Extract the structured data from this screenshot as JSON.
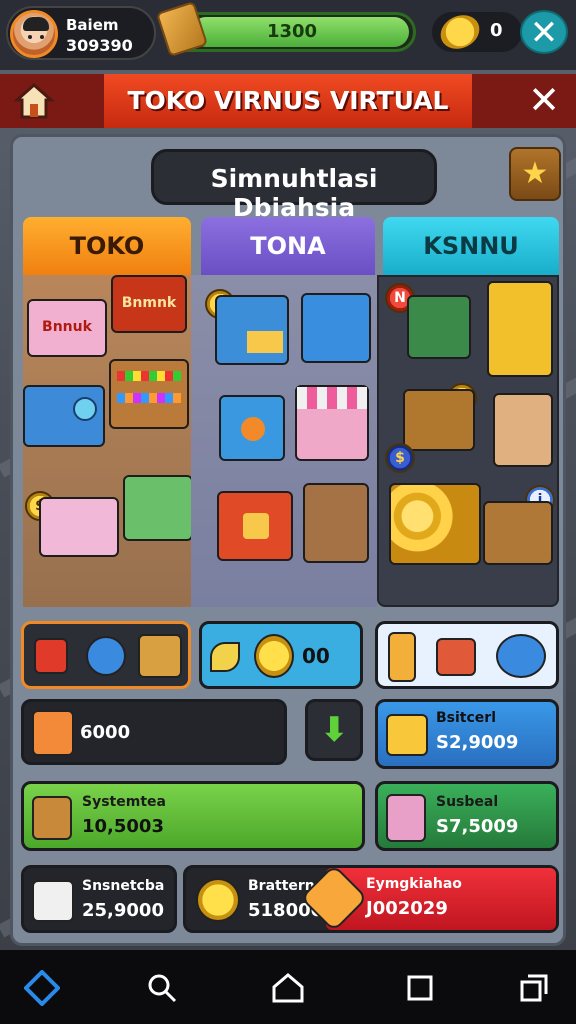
{
  "profile": {
    "name": "Baiem",
    "id": "309390"
  },
  "resource": {
    "value": "1300",
    "fill_fraction": 0.93
  },
  "coins": {
    "value": "0"
  },
  "header": {
    "title": "TOKO VIRNUS VIRTUAL"
  },
  "subtitle": "Simnuhtlasi Dbiahsia",
  "tabs": [
    {
      "label": "TOKO",
      "color": "#f08010"
    },
    {
      "label": "TONA",
      "color": "#6a4fc4"
    },
    {
      "label": "KSNNU",
      "color": "#18aecb"
    }
  ],
  "toko_items": {
    "sign1": "Bnnuk",
    "sign2": "Bnmnk"
  },
  "row1": {
    "middle_value": "00"
  },
  "row2": {
    "left_value": "6000",
    "right": {
      "label": "Bsitcerl",
      "value": "S2,9009"
    }
  },
  "row3": {
    "left": {
      "label": "Systemtea",
      "value": "10,5003"
    },
    "right": {
      "label": "Susbeal",
      "value": "S7,5009"
    }
  },
  "row4": {
    "a": {
      "label": "Snsnetcba",
      "value": "25,9000"
    },
    "b": {
      "label": "Brattern",
      "value": "5180001"
    },
    "c": {
      "label": "Eymgkiahao",
      "value": "J002029"
    }
  },
  "colors": {
    "green": "#5fc23a",
    "blue": "#2f86d8",
    "red": "#d8242a",
    "teal": "#1d9aa8",
    "orange": "#f08010"
  }
}
